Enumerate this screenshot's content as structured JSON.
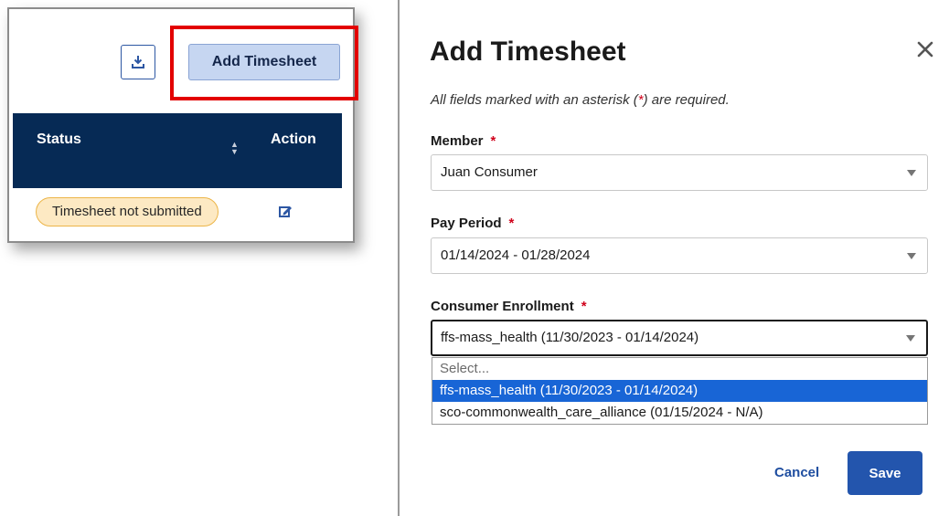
{
  "left_panel": {
    "add_timesheet_label": "Add Timesheet",
    "table_headers": {
      "status": "Status",
      "action": "Action"
    },
    "row": {
      "status": "Timesheet not submitted"
    }
  },
  "modal": {
    "title": "Add Timesheet",
    "required_note_prefix": "All fields marked with an asterisk (",
    "required_asterisk": "*",
    "required_note_suffix": ") are required.",
    "fields": {
      "member": {
        "label": "Member",
        "value": "Juan Consumer"
      },
      "pay_period": {
        "label": "Pay Period",
        "value": "01/14/2024 - 01/28/2024"
      },
      "consumer_enrollment": {
        "label": "Consumer Enrollment",
        "value": "ffs-mass_health (11/30/2023 - 01/14/2024)",
        "options": [
          "Select...",
          "ffs-mass_health (11/30/2023 - 01/14/2024)",
          "sco-commonwealth_care_alliance (01/15/2024 - N/A)"
        ],
        "selected_index": 1
      }
    },
    "cancel_label": "Cancel",
    "save_label": "Save"
  },
  "colors": {
    "header_navy": "#062a55",
    "highlight_red": "#e30000",
    "badge_bg": "#fde9c3",
    "save_blue": "#2355ad",
    "option_selected": "#1865d6"
  },
  "icons": [
    "download-icon",
    "sort-icon",
    "edit-icon",
    "close-icon",
    "chevron-down-icon"
  ]
}
